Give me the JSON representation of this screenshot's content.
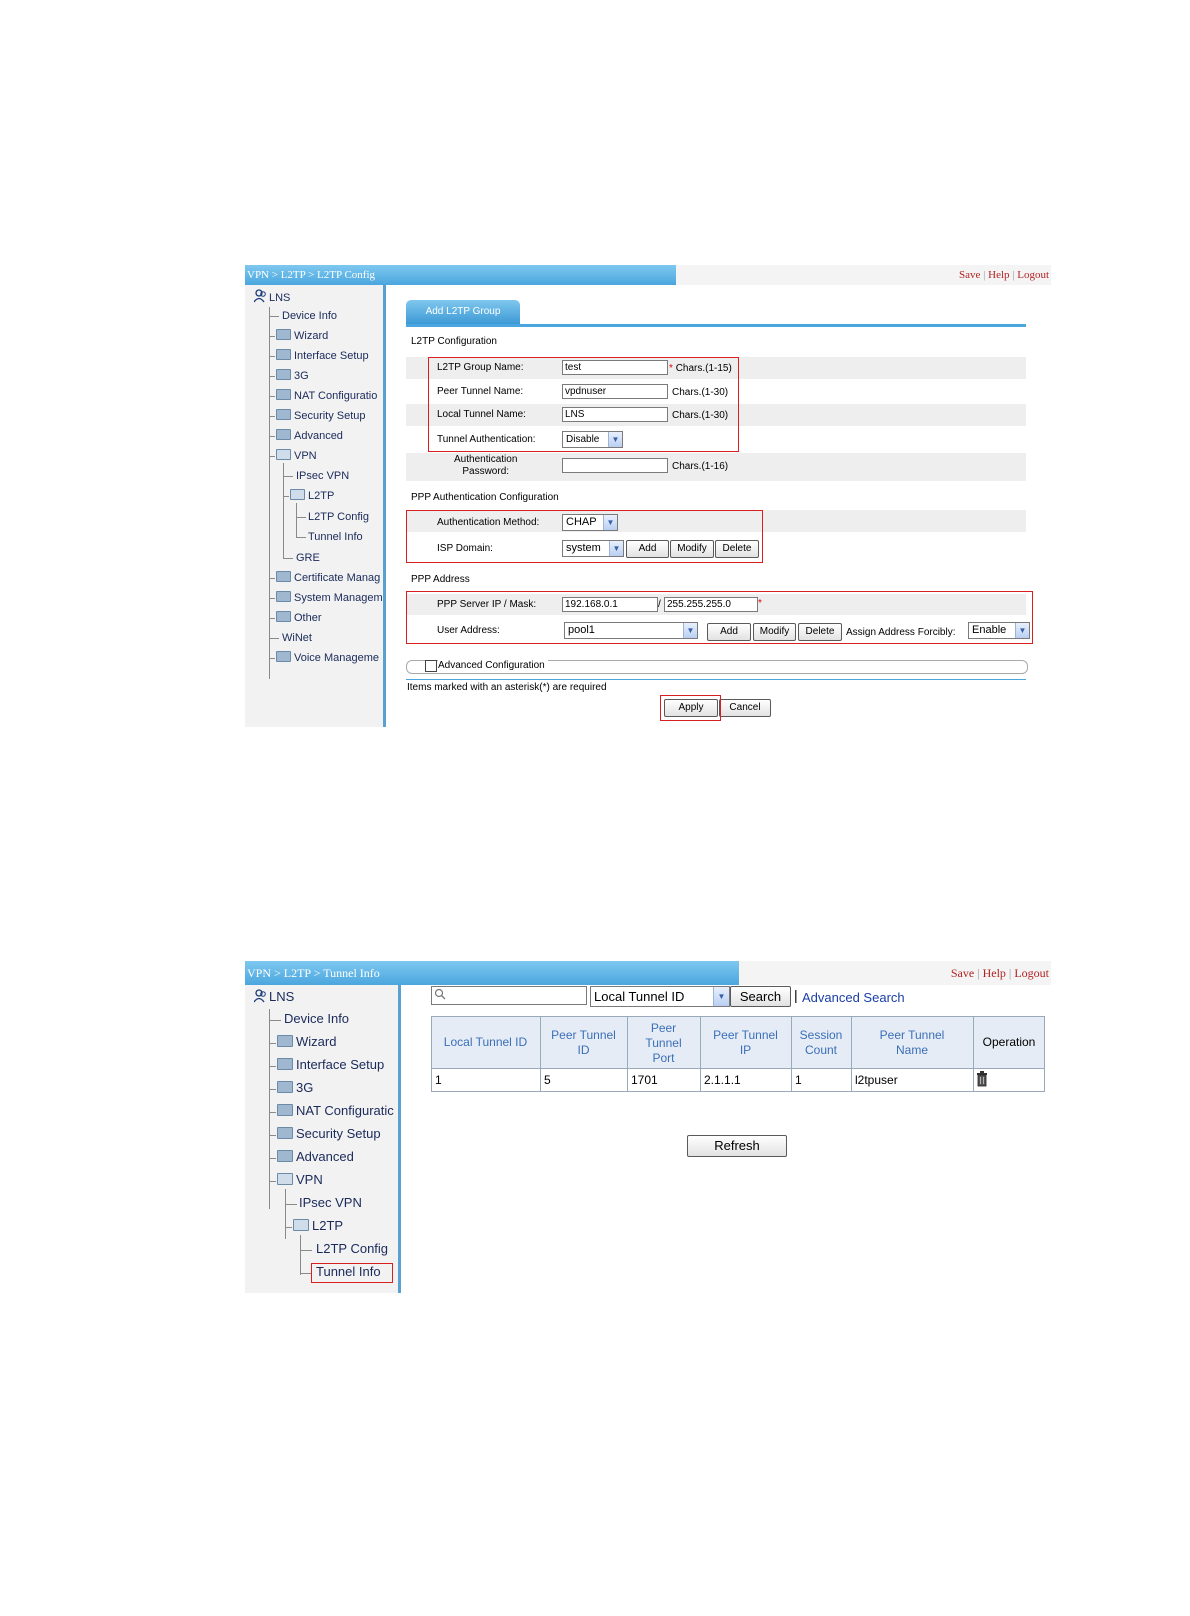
{
  "shot1": {
    "breadcrumb": "VPN > L2TP > L2TP Config",
    "toplinks": {
      "save": "Save",
      "help": "Help",
      "logout": "Logout",
      "sep": "|"
    },
    "nav": {
      "root": "LNS",
      "items": [
        "Device Info",
        "Wizard",
        "Interface Setup",
        "3G",
        "NAT Configuratio",
        "Security Setup",
        "Advanced",
        "VPN",
        "IPsec VPN",
        "L2TP",
        "L2TP Config",
        "Tunnel Info",
        "GRE",
        "Certificate Manag",
        "System Managem",
        "Other",
        "WiNet",
        "Voice Manageme"
      ]
    },
    "tab": "Add L2TP Group",
    "l2tp_section": "L2TP Configuration",
    "fields": {
      "group_name": {
        "label": "L2TP Group Name:",
        "value": "test",
        "hint": "Chars.(1-15)"
      },
      "peer_tunnel": {
        "label": "Peer Tunnel Name:",
        "value": "vpdnuser",
        "hint": "Chars.(1-30)"
      },
      "local_tunnel": {
        "label": "Local Tunnel Name:",
        "value": "LNS",
        "hint": "Chars.(1-30)"
      },
      "tunnel_auth": {
        "label": "Tunnel Authentication:",
        "value": "Disable"
      },
      "auth_password": {
        "label_1": "Authentication",
        "label_2": "Password:",
        "value": "",
        "hint": "Chars.(1-16)"
      }
    },
    "ppp_auth_section": "PPP Authentication Configuration",
    "auth_method": {
      "label": "Authentication Method:",
      "value": "CHAP"
    },
    "isp_domain": {
      "label": "ISP Domain:",
      "value": "system"
    },
    "buttons": {
      "add": "Add",
      "modify": "Modify",
      "delete": "Delete",
      "apply": "Apply",
      "cancel": "Cancel"
    },
    "ppp_address_section": "PPP Address",
    "server_ip": {
      "label": "PPP Server IP / Mask:",
      "ip": "192.168.0.1",
      "slash": "/",
      "mask": "255.255.255.0"
    },
    "user_address": {
      "label": "User Address:",
      "value": "pool1"
    },
    "assign_forcibly": {
      "label": "Assign Address Forcibly:",
      "value": "Enable"
    },
    "advanced": "Advanced Configuration",
    "required_note": "Items marked with an asterisk(*) are required",
    "asterisk": "*"
  },
  "shot2": {
    "breadcrumb": "VPN > L2TP > Tunnel Info",
    "toplinks": {
      "save": "Save",
      "help": "Help",
      "logout": "Logout",
      "sep": "|"
    },
    "nav": {
      "root": "LNS",
      "items": [
        "Device Info",
        "Wizard",
        "Interface Setup",
        "3G",
        "NAT Configuratic",
        "Security Setup",
        "Advanced",
        "VPN",
        "IPsec VPN",
        "L2TP",
        "L2TP Config",
        "Tunnel Info"
      ]
    },
    "search": {
      "value": "",
      "field": "Local Tunnel ID",
      "button": "Search",
      "sep": "|",
      "advanced": "Advanced Search"
    },
    "table": {
      "headers": [
        [
          "Local Tunnel ID"
        ],
        [
          "Peer Tunnel",
          "ID"
        ],
        [
          "Peer",
          "Tunnel",
          "Port"
        ],
        [
          "Peer Tunnel",
          "IP"
        ],
        [
          "Session",
          "Count"
        ],
        [
          "Peer Tunnel",
          "Name"
        ],
        [
          "Operation"
        ]
      ],
      "rows": [
        [
          "1",
          "5",
          "1701",
          "2.1.1.1",
          "1",
          "l2tpuser"
        ]
      ]
    },
    "refresh": "Refresh"
  },
  "colors": {
    "accent": "#4aa6de",
    "highlight": "#d82020",
    "link": "#b22222"
  }
}
